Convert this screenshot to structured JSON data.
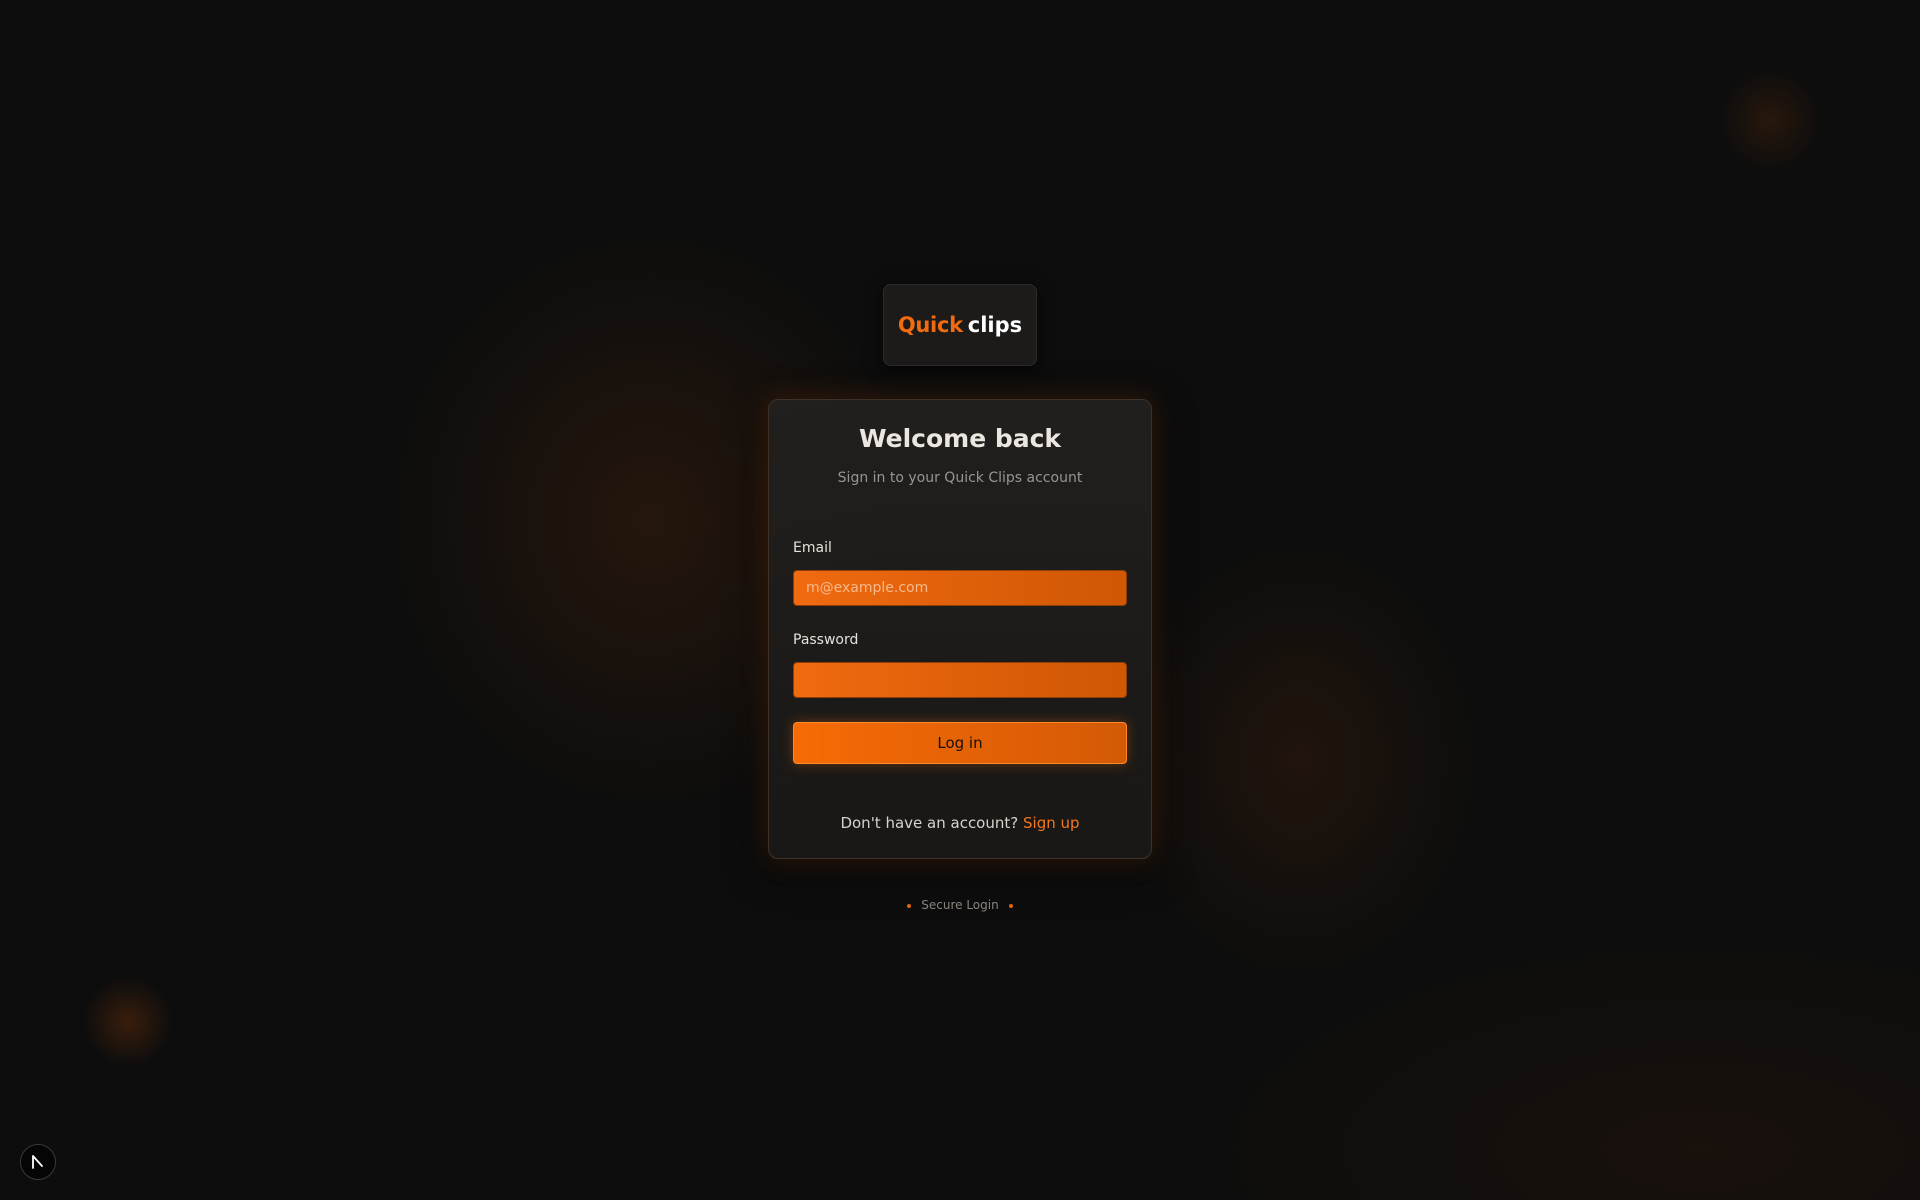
{
  "logo": {
    "part1": "Quick",
    "part2": "clips"
  },
  "card": {
    "title": "Welcome back",
    "subtitle": "Sign in to your Quick Clips account"
  },
  "form": {
    "email_label": "Email",
    "email_placeholder": "m@example.com",
    "email_value": "",
    "password_label": "Password",
    "password_value": "",
    "login_label": "Log in"
  },
  "signup": {
    "prompt": "Don't have an account?",
    "link_label": "Sign up"
  },
  "footer": {
    "secure_label": "Secure Login"
  },
  "corner": {
    "icon": "cursor-arrow-icon"
  },
  "colors": {
    "accent": "#f26b0f",
    "background": "#0d0d0d",
    "card": "#1e1c1a"
  }
}
